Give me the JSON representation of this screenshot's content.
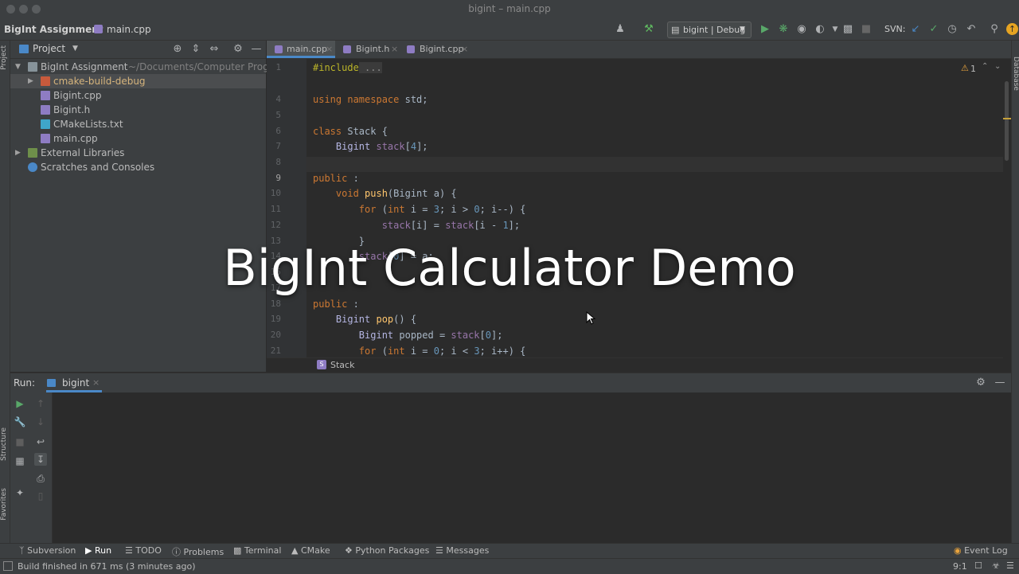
{
  "window": {
    "title": "bigint – main.cpp"
  },
  "navbar": {
    "project": "BigInt Assignment",
    "file": "main.cpp",
    "run_config": "bigint | Debug",
    "vcs_label": "SVN:"
  },
  "left_stripe": {
    "project_label": "Project",
    "structure_label": "Structure",
    "favorites_label": "Favorites"
  },
  "right_stripe": {
    "database_label": "Database"
  },
  "project_panel": {
    "title": "Project",
    "tree": [
      {
        "label": "BigInt Assignment",
        "hint": "~/Documents/Computer Progra"
      },
      {
        "label": "cmake-build-debug"
      },
      {
        "label": "Bigint.cpp"
      },
      {
        "label": "Bigint.h"
      },
      {
        "label": "CMakeLists.txt"
      },
      {
        "label": "main.cpp"
      },
      {
        "label": "External Libraries"
      },
      {
        "label": "Scratches and Consoles"
      }
    ]
  },
  "editor": {
    "tabs": [
      {
        "label": "main.cpp"
      },
      {
        "label": "Bigint.h"
      },
      {
        "label": "Bigint.cpp"
      }
    ],
    "warning_count": "1",
    "line_numbers": [
      "1",
      "4",
      "5",
      "6",
      "7",
      "8",
      "9",
      "10",
      "11",
      "12",
      "13",
      "14",
      "15",
      "17",
      "18",
      "19",
      "20",
      "21"
    ],
    "breadcrumb": "Stack"
  },
  "code": {
    "l1a": "#include",
    "l1b": " ...",
    "l5a": "using namespace",
    "l5b": " std;",
    "l7a": "class",
    "l7b": " Stack {",
    "l8a": "    Bigint",
    "l8b": " stack",
    "l8c": "[",
    "l8d": "4",
    "l8e": "];",
    "l10a": "public",
    "l10b": " :",
    "l11a": "    void",
    "l11b": " push",
    "l11c": "(Bigint a) {",
    "l12a": "        for",
    "l12b": " (",
    "l12c": "int",
    "l12d": " i = ",
    "l12e": "3",
    "l12f": "; i > ",
    "l12g": "0",
    "l12h": "; i--) {",
    "l13a": "            stack",
    "l13b": "[i] = ",
    "l13c": "stack",
    "l13d": "[i - ",
    "l13e": "1",
    "l13f": "];",
    "l14": "        }",
    "l15a": "        stack",
    "l15b": "[",
    "l15c": "0",
    "l15d": "] = a;",
    "l18a": "public",
    "l18b": " :",
    "l19a": "    Bigint",
    "l19b": " pop",
    "l19c": "() {",
    "l20a": "        Bigint",
    "l20b": " popped = ",
    "l20c": "stack",
    "l20d": "[",
    "l20e": "0",
    "l20f": "];",
    "l21a": "        for",
    "l21b": " (",
    "l21c": "int",
    "l21d": " i = ",
    "l21e": "0",
    "l21f": "; i < ",
    "l21g": "3",
    "l21h": "; i++) {"
  },
  "run_panel": {
    "label": "Run:",
    "tab": "bigint"
  },
  "bottom_tools": [
    {
      "label": "Subversion"
    },
    {
      "label": "Run"
    },
    {
      "label": "TODO"
    },
    {
      "label": "Problems"
    },
    {
      "label": "Terminal"
    },
    {
      "label": "CMake"
    },
    {
      "label": "Python Packages"
    },
    {
      "label": "Messages"
    }
  ],
  "event_log": "Event Log",
  "status": {
    "message": "Build finished in 671 ms (3 minutes ago)",
    "position": "9:1"
  },
  "overlay": {
    "title": "BigInt Calculator Demo"
  },
  "colors": {
    "background": "#2b2b2b",
    "panel": "#3c3f41",
    "keyword": "#cc7832",
    "number": "#6897bb",
    "function": "#ffc66d",
    "field": "#9876aa",
    "accent": "#4a88c7"
  }
}
